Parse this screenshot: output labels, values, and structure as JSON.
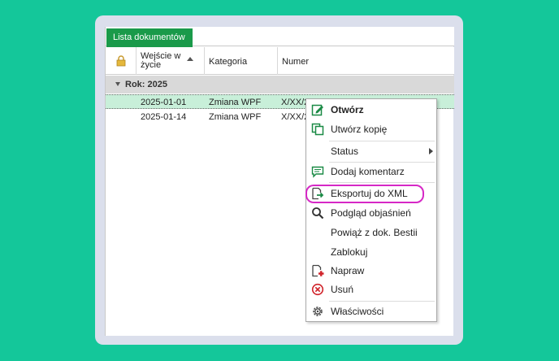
{
  "tabs": [
    {
      "label": "Lista dokumentów"
    }
  ],
  "grid": {
    "columns": {
      "lock_icon": "lock-icon",
      "date": "Wejście w życie",
      "category": "Kategoria",
      "number": "Numer"
    },
    "group": {
      "label": "Rok: 2025"
    },
    "rows": [
      {
        "date": "2025-01-01",
        "category": "Zmiana WPF",
        "number": "X/XX/2025"
      },
      {
        "date": "2025-01-14",
        "category": "Zmiana WPF",
        "number": "X/XX/2025"
      }
    ]
  },
  "context_menu": {
    "items": [
      {
        "label": "Otwórz",
        "icon": "edit-icon"
      },
      {
        "label": "Utwórz kopię",
        "icon": "copy-icon"
      },
      {
        "label": "Status",
        "icon": ""
      },
      {
        "label": "Dodaj komentarz",
        "icon": "comment-icon"
      },
      {
        "label": "Eksportuj do XML",
        "icon": "export-icon"
      },
      {
        "label": "Podgląd objaśnień",
        "icon": "search-icon"
      },
      {
        "label": "Powiąż z dok. Bestii",
        "icon": ""
      },
      {
        "label": "Zablokuj",
        "icon": ""
      },
      {
        "label": "Napraw",
        "icon": "repair-icon"
      },
      {
        "label": "Usuń",
        "icon": "delete-icon"
      },
      {
        "label": "Właściwości",
        "icon": "gear-icon"
      }
    ]
  },
  "colors": {
    "background": "#14c79a",
    "tab": "#1a9a4a",
    "selected_row": "#c8efd9",
    "highlight": "#d628c6"
  }
}
